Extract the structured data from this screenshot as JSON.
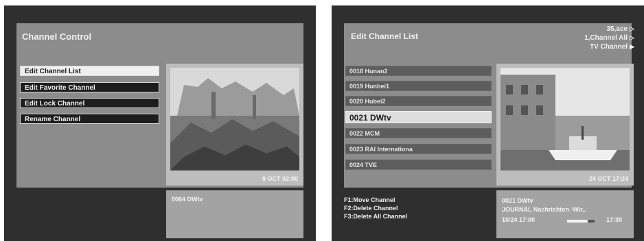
{
  "screen1": {
    "title": "Channel Control",
    "menu": [
      {
        "label": "Edit Channel List",
        "selected": true
      },
      {
        "label": "Edit Favorite Channel",
        "selected": false
      },
      {
        "label": "Edit Lock Channel",
        "selected": false
      },
      {
        "label": "Rename Channel",
        "selected": false
      }
    ],
    "preview_time": "9 OCT 02:00",
    "info_channel": "0064 DWtv"
  },
  "screen2": {
    "title": "Edit Channel List",
    "header_right": [
      "35,ace",
      "1,Channel All",
      "TV Channel"
    ],
    "channels": [
      {
        "label": "0018 Hunan2",
        "selected": false
      },
      {
        "label": "0019 Hunbei1",
        "selected": false
      },
      {
        "label": "0020 Hubei2",
        "selected": false
      },
      {
        "label": "0021 DWtv",
        "selected": true
      },
      {
        "label": "0022 MCM",
        "selected": false
      },
      {
        "label": "0023 RAI Internationa",
        "selected": false
      },
      {
        "label": "0024 TVE",
        "selected": false
      }
    ],
    "preview_time": "24 OCT 17:24",
    "fkeys": [
      "F1:Move Channel",
      "F2:Delete Channel",
      "F3:Delete All Channel"
    ],
    "info": {
      "channel": "0021 DWtv",
      "program": "JOURNAL Nachrichten -Wir..",
      "start": "10/24 17:00",
      "end": "17:30",
      "progress": 0.75
    }
  },
  "colors": {
    "screen_bg": "#2f2f2f",
    "panel": "#8c8c8c",
    "selected_item": "#efefef",
    "dark_item": "#1d1d1d"
  }
}
